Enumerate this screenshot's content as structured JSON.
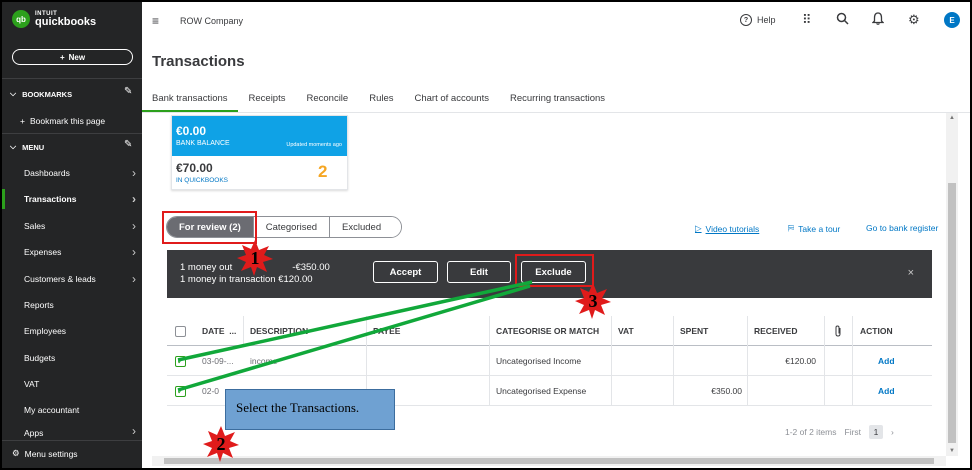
{
  "brand": {
    "line1": "INTUIT",
    "line2": "quickbooks",
    "mark": "qb"
  },
  "sidebar": {
    "new_label": "New",
    "bookmarks_label": "BOOKMARKS",
    "bookmark_this_page": "Bookmark this page",
    "menu_label": "MENU",
    "items": [
      {
        "label": "Dashboards"
      },
      {
        "label": "Transactions"
      },
      {
        "label": "Sales"
      },
      {
        "label": "Expenses"
      },
      {
        "label": "Customers & leads"
      },
      {
        "label": "Reports"
      },
      {
        "label": "Employees"
      },
      {
        "label": "Budgets"
      },
      {
        "label": "VAT"
      },
      {
        "label": "My accountant"
      },
      {
        "label": "Apps"
      }
    ],
    "menu_settings": "Menu settings"
  },
  "header": {
    "company": "ROW Company",
    "help": "Help",
    "avatar_initial": "E",
    "icons": [
      "menu-icon",
      "help-icon",
      "apps-grid-icon",
      "search-icon",
      "bell-icon",
      "gear-icon"
    ]
  },
  "page": {
    "title": "Transactions"
  },
  "tabs": [
    {
      "label": "Bank transactions"
    },
    {
      "label": "Receipts"
    },
    {
      "label": "Reconcile"
    },
    {
      "label": "Rules"
    },
    {
      "label": "Chart of accounts"
    },
    {
      "label": "Recurring transactions"
    }
  ],
  "bank_card": {
    "bank_balance_amount": "€0.00",
    "bank_balance_label": "BANK BALANCE",
    "updated": "Updated moments ago",
    "qb_amount": "€70.00",
    "qb_label": "IN QUICKBOOKS"
  },
  "review_tabs": [
    {
      "label": "For review (2)"
    },
    {
      "label": "Categorised"
    },
    {
      "label": "Excluded"
    }
  ],
  "links": {
    "video": "Video tutorials",
    "tour": "Take a tour",
    "register": "Go to bank register"
  },
  "batch": {
    "line1_prefix": "1 money out",
    "line1_suffix": "-€350.00",
    "line2": "1 money in transaction €120.00",
    "accept": "Accept",
    "edit": "Edit",
    "exclude": "Exclude",
    "close": "×"
  },
  "table": {
    "headers": [
      "DATE",
      "DESCRIPTION",
      "PAYEE",
      "CATEGORISE OR MATCH",
      "VAT",
      "SPENT",
      "RECEIVED",
      "ACTION"
    ],
    "rows": [
      {
        "date": "03-09-...",
        "description": "income",
        "payee": "",
        "category": "Uncategorised Income",
        "vat": "",
        "spent": "",
        "received": "€120.00",
        "action": "Add"
      },
      {
        "date": "02-0",
        "description": "",
        "payee": "",
        "category": "Uncategorised Expense",
        "vat": "",
        "spent": "€350.00",
        "received": "",
        "action": "Add"
      }
    ]
  },
  "pager": {
    "range": "1-2 of 2 items",
    "first": "First",
    "page": "1"
  },
  "annotations": {
    "step1": "1",
    "step2": "2",
    "step3": "3",
    "card_number": "2",
    "callout": "Select the Transactions.",
    "colors": {
      "red": "#e01b1b",
      "badge": "#e01b1b",
      "line": "#11a83a",
      "callout_bg": "#6fa1d2"
    }
  }
}
